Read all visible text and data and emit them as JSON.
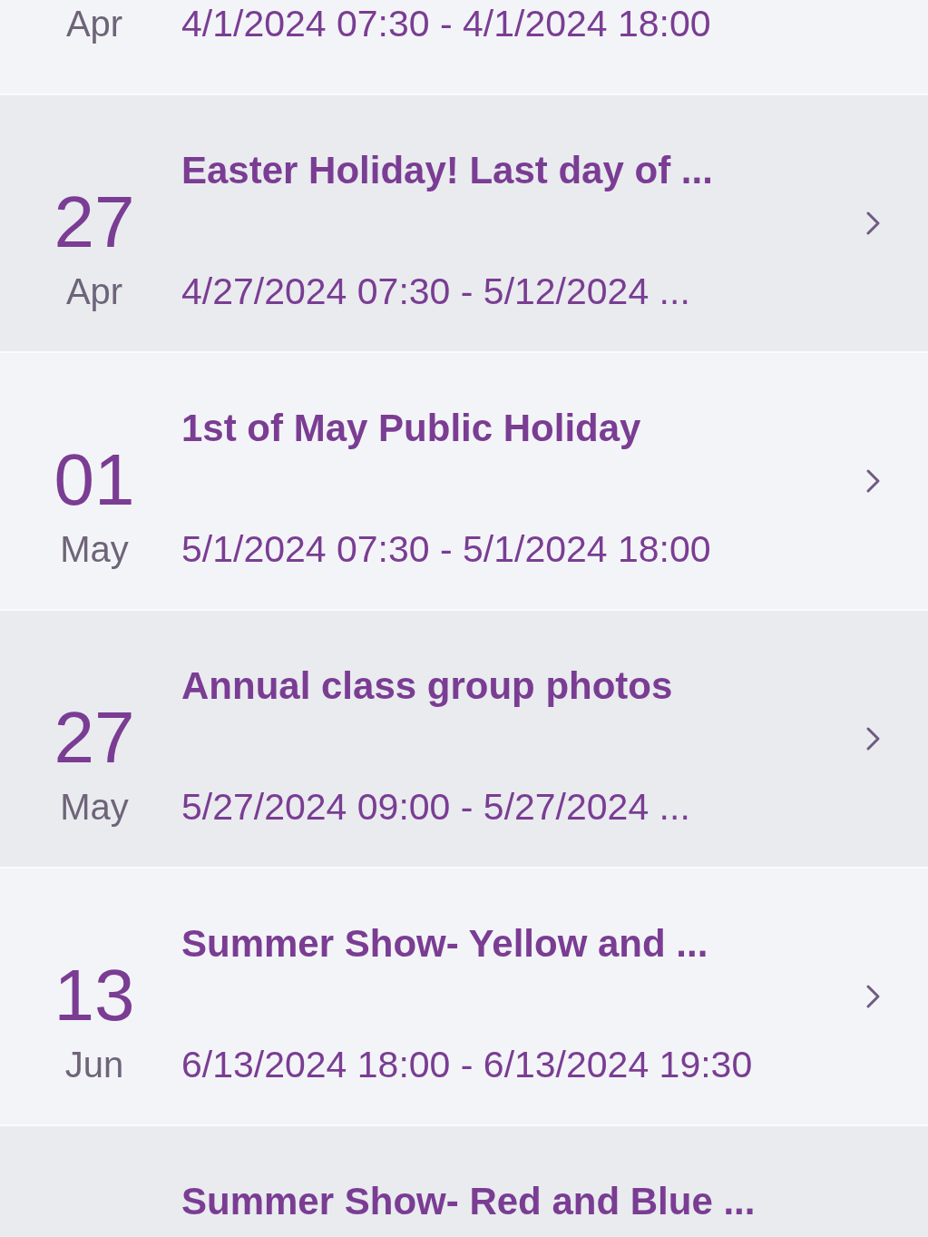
{
  "events": [
    {
      "month": "Apr",
      "dates": "4/1/2024 07:30 - 4/1/2024 18:00"
    },
    {
      "day": "27",
      "month": "Apr",
      "title": "Easter Holiday! Last day of ...",
      "dates": "4/27/2024 07:30 - 5/12/2024 ..."
    },
    {
      "day": "01",
      "month": "May",
      "title": "1st of May Public Holiday",
      "dates": "5/1/2024 07:30 - 5/1/2024 18:00"
    },
    {
      "day": "27",
      "month": "May",
      "title": "Annual class group photos",
      "dates": "5/27/2024 09:00 - 5/27/2024 ..."
    },
    {
      "day": "13",
      "month": "Jun",
      "title": "Summer Show- Yellow and ...",
      "dates": "6/13/2024 18:00 - 6/13/2024 19:30"
    },
    {
      "title": "Summer Show- Red and Blue ..."
    }
  ]
}
